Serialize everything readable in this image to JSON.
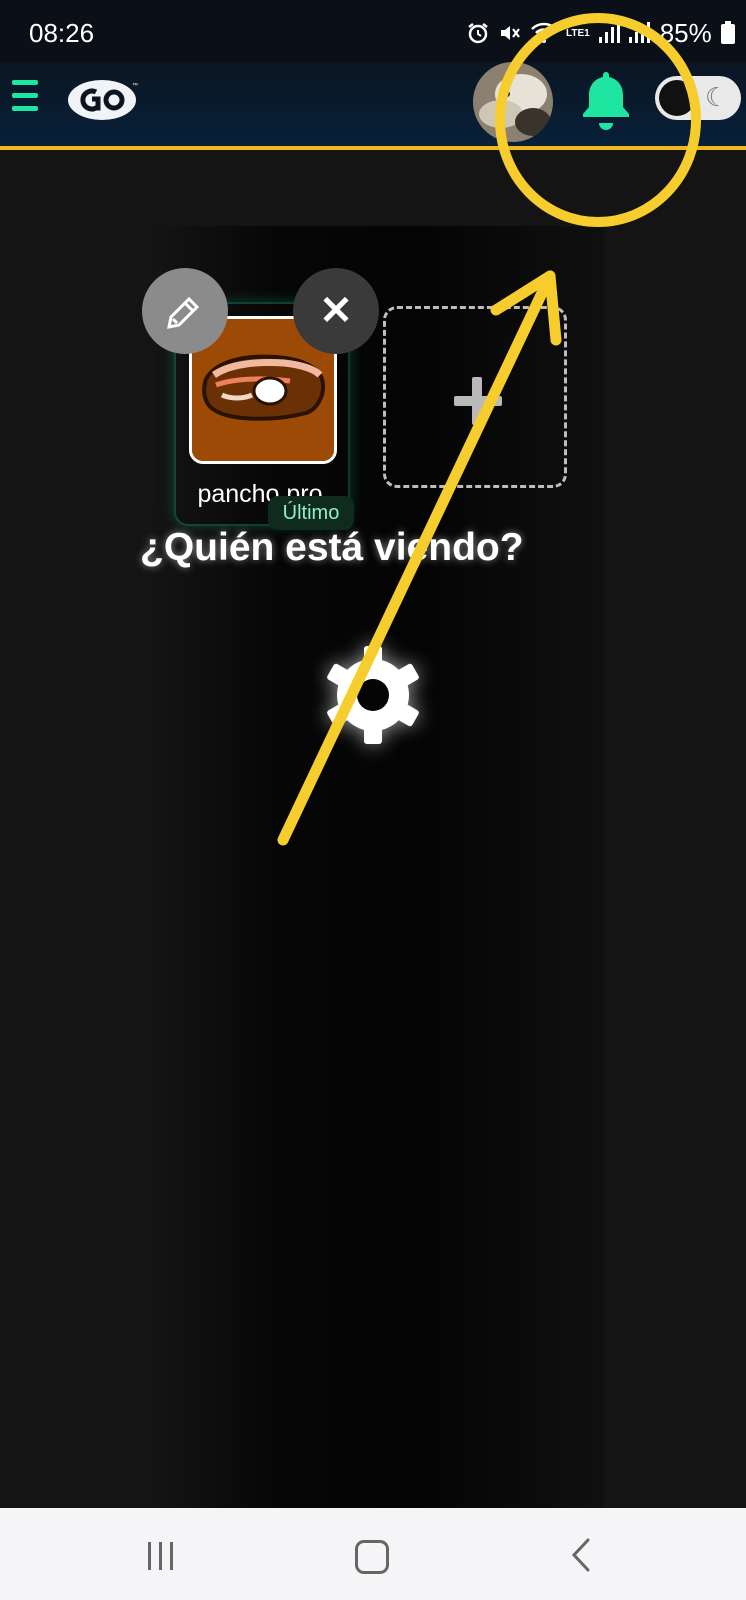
{
  "status_bar": {
    "time": "08:26",
    "battery": "85%",
    "network": "LTE1",
    "icons": [
      "alarm-icon",
      "mute-icon",
      "wifi-icon",
      "signal-icon",
      "signal-icon",
      "battery-icon"
    ]
  },
  "header": {
    "menu_icon": "hamburger-icon",
    "logo_text": "GO",
    "notification_icon": "bell-icon",
    "theme_icon": "moon-icon",
    "moon_glyph": "☾",
    "accent_color": "#1ee6a0",
    "border_color": "#f2b617"
  },
  "profiles": {
    "items": [
      {
        "name": "pancho.pro",
        "badge": "Último"
      }
    ],
    "edit_glyph": "✎",
    "remove_glyph": "✕",
    "add_icon": "plus-icon"
  },
  "main": {
    "heading": "¿Quién está viendo?",
    "settings_icon": "gear-icon"
  },
  "annotation": {
    "color": "#f7cd2e",
    "shapes": [
      "highlight-circle",
      "arrow"
    ]
  },
  "nav_bar": {
    "buttons": [
      "recents-icon",
      "home-icon",
      "back-icon"
    ]
  }
}
